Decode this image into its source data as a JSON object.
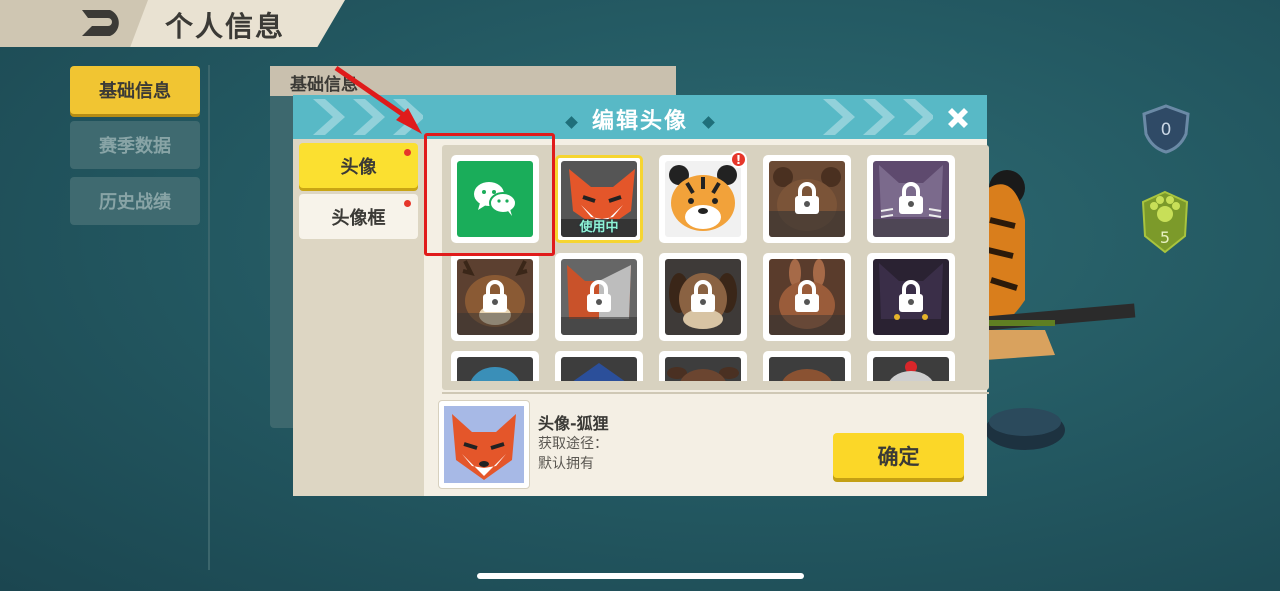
{
  "header": {
    "title": "个人信息",
    "back_icon": "back-arrow-icon"
  },
  "nav": {
    "items": [
      {
        "label": "基础信息",
        "active": true
      },
      {
        "label": "赛季数据",
        "active": false
      },
      {
        "label": "历史战绩",
        "active": false
      }
    ]
  },
  "underlying_panel": {
    "header": "基础信息"
  },
  "right_badges": {
    "level": "0",
    "paw_count": "5"
  },
  "modal": {
    "title": "编辑头像",
    "tabs": [
      {
        "label": "头像",
        "active": true,
        "has_dot": true
      },
      {
        "label": "头像框",
        "active": false,
        "has_dot": true
      }
    ],
    "avatars": [
      {
        "name": "wechat-avatar",
        "locked": false
      },
      {
        "name": "fox-avatar",
        "locked": false,
        "status": "使用中"
      },
      {
        "name": "tiger-avatar",
        "locked": false,
        "alert": "!"
      },
      {
        "name": "bear-avatar",
        "locked": true
      },
      {
        "name": "cat-avatar",
        "locked": true
      },
      {
        "name": "deer-avatar",
        "locked": true
      },
      {
        "name": "calico-avatar",
        "locked": true
      },
      {
        "name": "dog-avatar",
        "locked": true
      },
      {
        "name": "rabbit-avatar",
        "locked": true
      },
      {
        "name": "black-cat-avatar",
        "locked": true
      },
      {
        "name": "fish-avatar",
        "locked": true
      },
      {
        "name": "shark-avatar",
        "locked": true
      },
      {
        "name": "cow-avatar",
        "locked": true
      },
      {
        "name": "brown-avatar",
        "locked": true
      },
      {
        "name": "chicken-avatar",
        "locked": true
      }
    ],
    "selected": {
      "name": "头像-狐狸",
      "obtain_label": "获取途径：",
      "obtain_value": "默认拥有"
    },
    "confirm_label": "确定"
  },
  "colors": {
    "accent_yellow": "#fbd728",
    "title_bar": "#58b9c6",
    "annotation_red": "#e01b1b",
    "wechat_green": "#1aad5a"
  }
}
